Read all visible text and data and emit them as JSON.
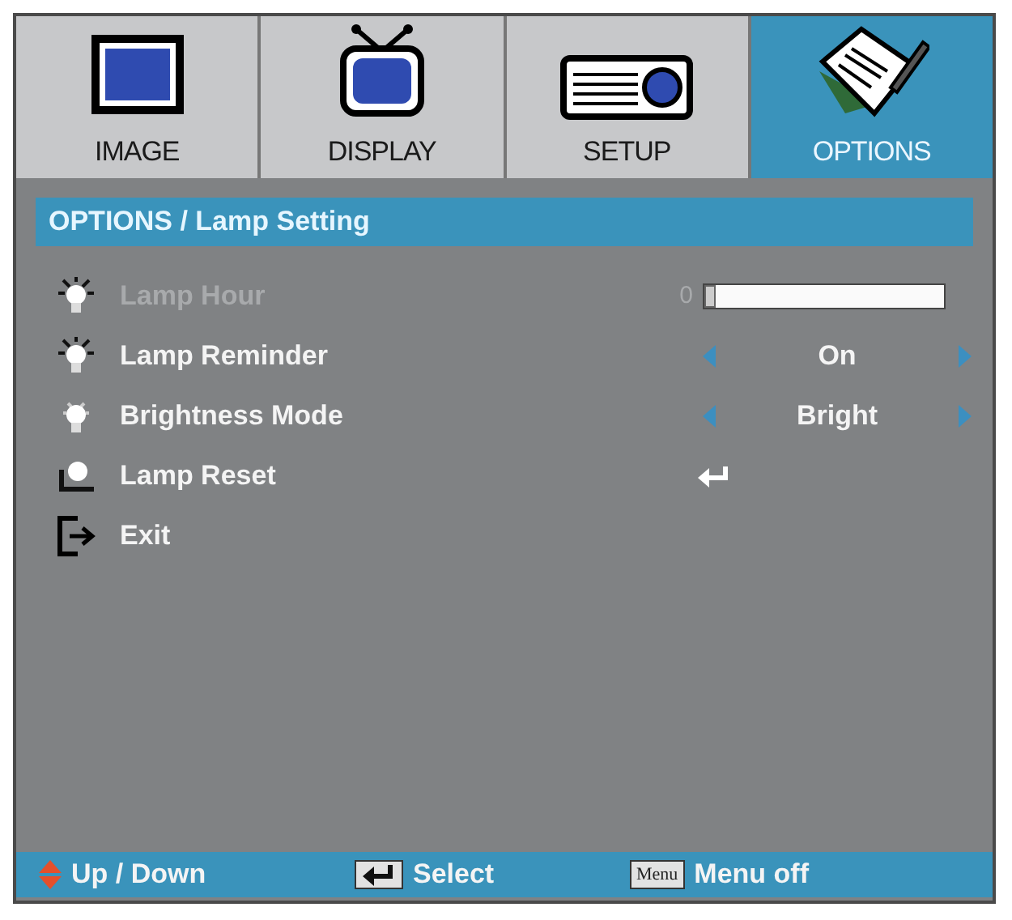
{
  "tabs": [
    {
      "label": "IMAGE",
      "selected": false
    },
    {
      "label": "DISPLAY",
      "selected": false
    },
    {
      "label": "SETUP",
      "selected": false
    },
    {
      "label": "OPTIONS",
      "selected": true
    }
  ],
  "header": "OPTIONS / Lamp Setting",
  "items": [
    {
      "kind": "slider",
      "label": "Lamp Hour",
      "disabled": true,
      "reading": "0",
      "level": 0
    },
    {
      "kind": "choice",
      "label": "Lamp Reminder",
      "disabled": false,
      "value": "On"
    },
    {
      "kind": "choice",
      "label": "Brightness Mode",
      "disabled": false,
      "value": "Bright"
    },
    {
      "kind": "action",
      "label": "Lamp Reset",
      "disabled": false
    },
    {
      "kind": "exit",
      "label": "Exit",
      "disabled": false
    }
  ],
  "footer": [
    {
      "kind": "arrows",
      "label": "Up / Down"
    },
    {
      "kind": "enter",
      "label": "Select"
    },
    {
      "kind": "key",
      "key": "Menu",
      "label": "Menu off"
    }
  ]
}
